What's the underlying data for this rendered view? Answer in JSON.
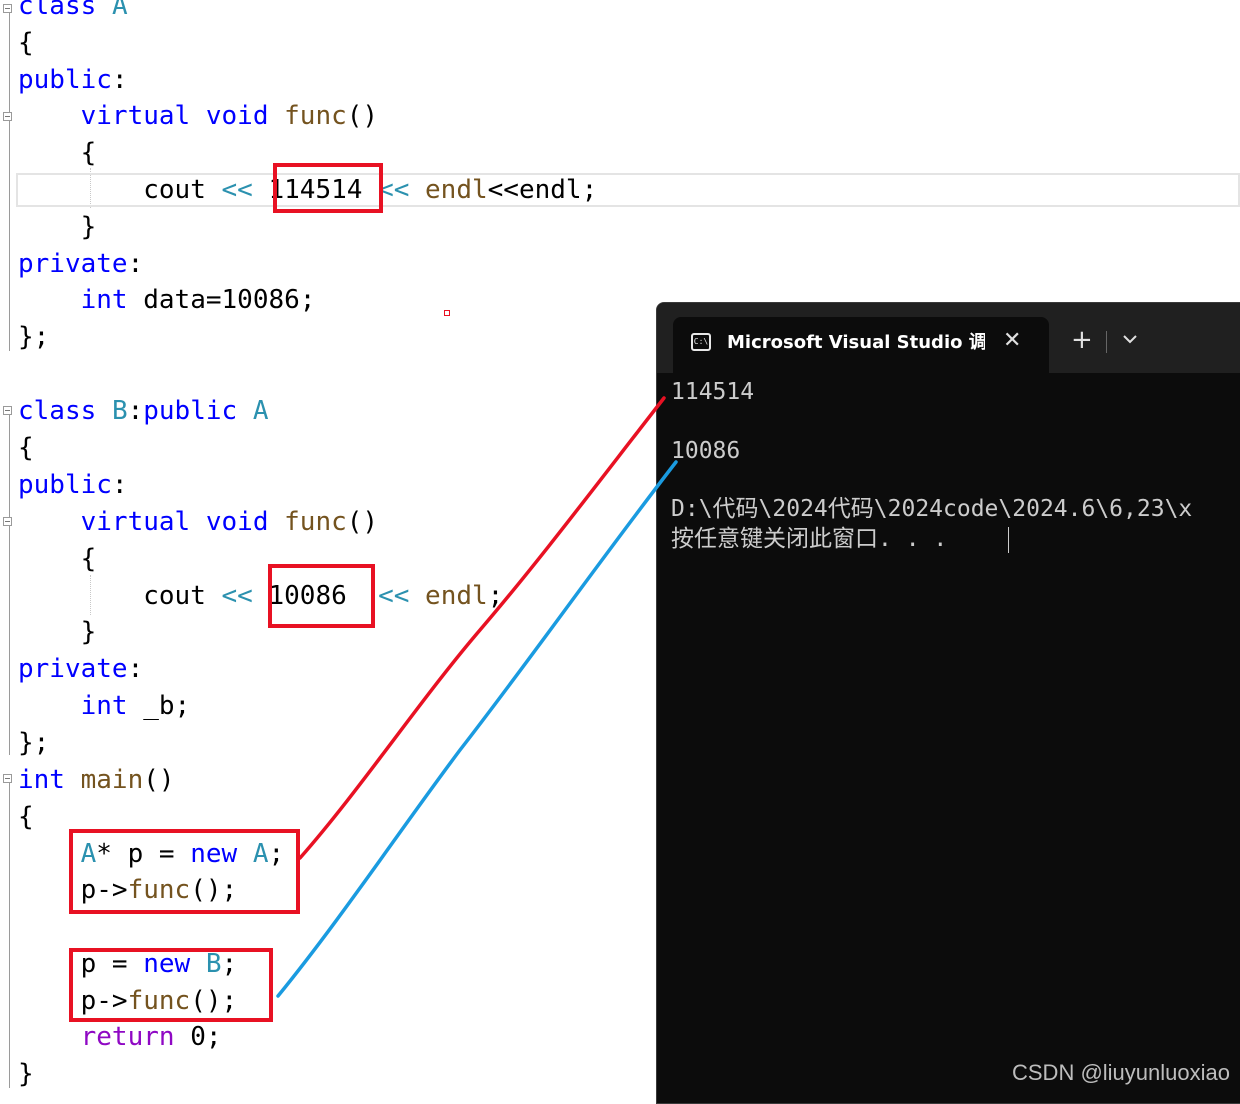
{
  "code": {
    "class_a": {
      "l1_kw": "class",
      "l1_name": "A",
      "l2": "{",
      "l3_kw": "public",
      "l3_colon": ":",
      "l4_kw1": "virtual",
      "l4_kw2": "void",
      "l4_fn": "func",
      "l4_paren": "()",
      "l5": "{",
      "l6_cout": "cout",
      "l6_op1": "<<",
      "l6_num": "114514",
      "l6_op2": "<<",
      "l6_endl": "endl",
      "l6_rest": "<<endl;",
      "l7": "}",
      "l8_kw": "private",
      "l8_colon": ":",
      "l9_kw": "int",
      "l9_rest": "data=10086;",
      "l10": "};"
    },
    "class_b": {
      "l1_kw": "class",
      "l1_name": "B",
      "l1_colon": ":",
      "l1_kw2": "public",
      "l1_base": "A",
      "l2": "{",
      "l3_kw": "public",
      "l3_colon": ":",
      "l4_kw1": "virtual",
      "l4_kw2": "void",
      "l4_fn": "func",
      "l4_paren": "()",
      "l5": "{",
      "l6_cout": "cout",
      "l6_op1": "<<",
      "l6_num": "10086",
      "l6_op2": "<<",
      "l6_endl": "endl",
      "l6_semi": ";",
      "l7": "}",
      "l8_kw": "private",
      "l8_colon": ":",
      "l9_kw": "int",
      "l9_rest": "_b;",
      "l10": "};"
    },
    "main_fn": {
      "l1_kw": "int",
      "l1_fn": "main",
      "l1_paren": "()",
      "l2": "{",
      "l3_type": "A",
      "l3_mid": "* p = ",
      "l3_new": "new",
      "l3_type2": "A",
      "l3_semi": ";",
      "l4_pre": "p->",
      "l4_fn": "func",
      "l4_post": "();",
      "l5_pre": "p = ",
      "l5_new": "new",
      "l5_type": "B",
      "l5_semi": ";",
      "l6_pre": "p->",
      "l6_fn": "func",
      "l6_post": "();",
      "l7_kw": "return",
      "l7_rest": "0;",
      "l8": "}"
    }
  },
  "console": {
    "tab_title": "Microsoft Visual Studio 调试控制台",
    "tab_icon_text": "C:\\",
    "close_glyph": "✕",
    "add_glyph": "+",
    "output": [
      "114514",
      "",
      "10086",
      "",
      "D:\\代码\\2024代码\\2024code\\2024.6\\6,23\\x",
      "按任意键关闭此窗口. . ."
    ]
  },
  "annotations": {
    "arrow_red_color": "#e81123",
    "arrow_blue_color": "#1a9be0",
    "box_color": "#e81123"
  },
  "watermark": "CSDN @liuyunluoxiao"
}
